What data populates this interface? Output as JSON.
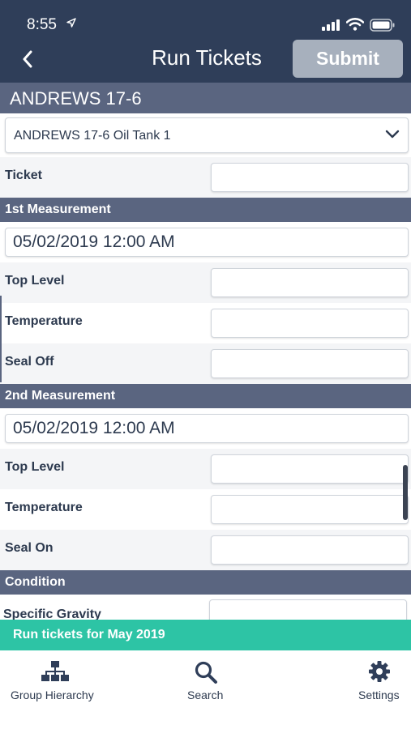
{
  "status_bar": {
    "time": "8:55"
  },
  "nav": {
    "title": "Run Tickets",
    "submit_label": "Submit"
  },
  "well": {
    "name": "ANDREWS 17-6"
  },
  "tank_select": {
    "value": "ANDREWS 17-6 Oil Tank 1"
  },
  "ticket": {
    "label": "Ticket",
    "value": ""
  },
  "first_measurement": {
    "header": "1st Measurement",
    "datetime": "05/02/2019 12:00 AM",
    "top_level_label": "Top Level",
    "temperature_label": "Temperature",
    "seal_label": "Seal Off"
  },
  "second_measurement": {
    "header": "2nd Measurement",
    "datetime": "05/02/2019 12:00 AM",
    "top_level_label": "Top Level",
    "temperature_label": "Temperature",
    "seal_label": "Seal On"
  },
  "condition": {
    "header": "Condition",
    "specific_gravity_label": "Specific Gravity"
  },
  "banner": {
    "text": "Run tickets for May 2019"
  },
  "tabbar": {
    "group_hierarchy": "Group Hierarchy",
    "search": "Search",
    "settings": "Settings"
  },
  "colors": {
    "header_bg": "#2f3e59",
    "section_bg": "#5a6580",
    "banner_bg": "#2dc4a5",
    "submit_bg": "#a7b0bd"
  }
}
